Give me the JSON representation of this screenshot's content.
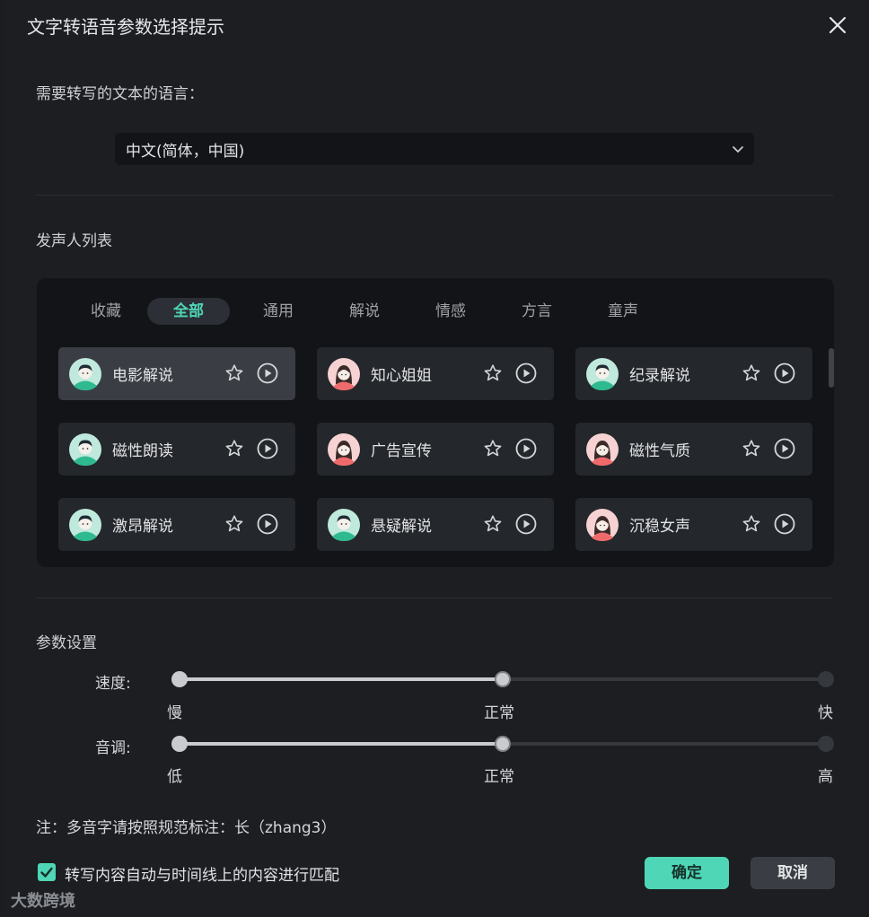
{
  "dialog": {
    "title": "文字转语音参数选择提示",
    "language_label": "需要转写的文本的语言：",
    "language_value": "中文(简体，中国)",
    "speakers_label": "发声人列表",
    "params_label": "参数设置"
  },
  "tabs": [
    {
      "label": "收藏",
      "active": false
    },
    {
      "label": "全部",
      "active": true
    },
    {
      "label": "通用",
      "active": false
    },
    {
      "label": "解说",
      "active": false
    },
    {
      "label": "情感",
      "active": false
    },
    {
      "label": "方言",
      "active": false
    },
    {
      "label": "童声",
      "active": false
    }
  ],
  "speakers": [
    {
      "name": "电影解说",
      "gender": "male",
      "selected": true
    },
    {
      "name": "知心姐姐",
      "gender": "female",
      "selected": false
    },
    {
      "name": "纪录解说",
      "gender": "male",
      "selected": false
    },
    {
      "name": "磁性朗读",
      "gender": "male",
      "selected": false
    },
    {
      "name": "广告宣传",
      "gender": "female",
      "selected": false
    },
    {
      "name": "磁性气质",
      "gender": "female",
      "selected": false
    },
    {
      "name": "激昂解说",
      "gender": "male",
      "selected": false
    },
    {
      "name": "悬疑解说",
      "gender": "male",
      "selected": false
    },
    {
      "name": "沉稳女声",
      "gender": "female",
      "selected": false
    }
  ],
  "speed": {
    "label": "速度:",
    "min_label": "慢",
    "mid_label": "正常",
    "max_label": "快",
    "level": 0.5
  },
  "pitch": {
    "label": "音调:",
    "min_label": "低",
    "mid_label": "正常",
    "max_label": "高",
    "level": 0.5
  },
  "note": "注：多音字请按照规范标注：长（zhang3）",
  "auto_match": {
    "label": "转写内容自动与时间线上的内容进行匹配",
    "checked": true
  },
  "buttons": {
    "ok": "确定",
    "cancel": "取消"
  },
  "watermark": "大数跨境",
  "colors": {
    "accent": "#4fd6b6",
    "background": "#1c1e21",
    "panel": "#121417"
  }
}
